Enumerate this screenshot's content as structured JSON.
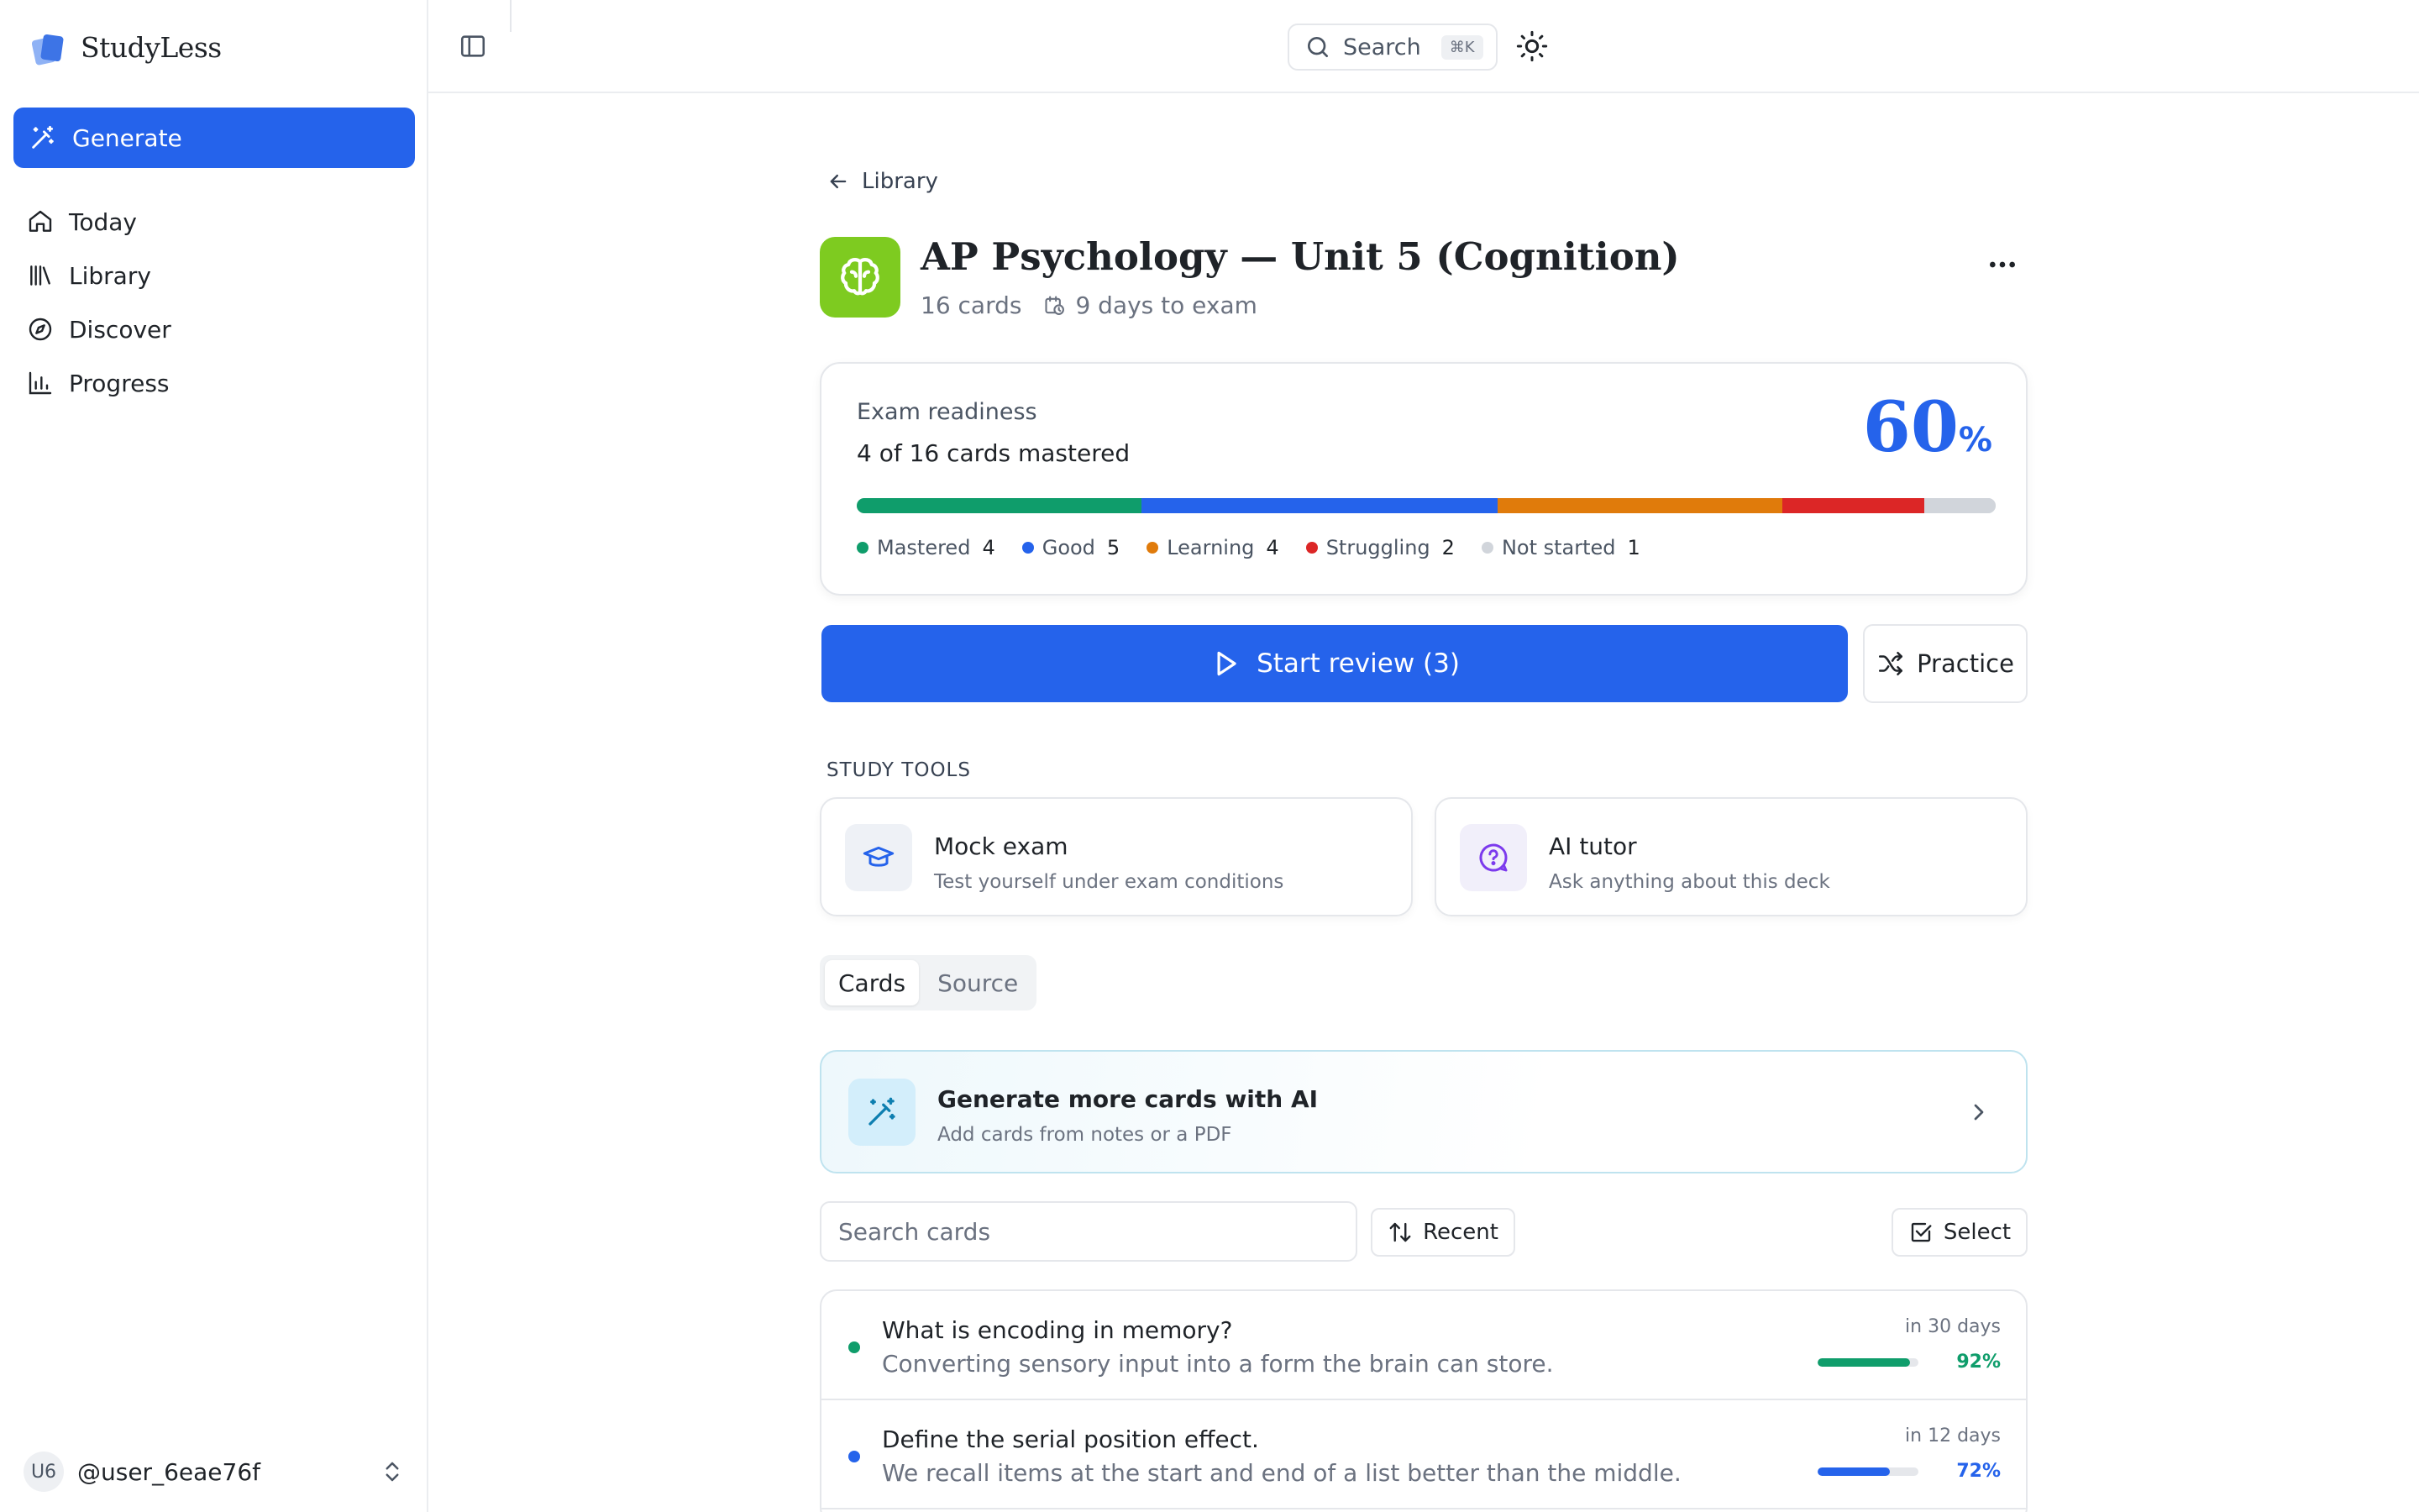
{
  "app": {
    "name": "StudyLess"
  },
  "sidebar": {
    "generate_label": "Generate",
    "items": [
      {
        "label": "Today",
        "icon": "home-icon"
      },
      {
        "label": "Library",
        "icon": "library-icon"
      },
      {
        "label": "Discover",
        "icon": "compass-icon"
      },
      {
        "label": "Progress",
        "icon": "bar-chart-icon"
      }
    ],
    "user": {
      "initials": "U6",
      "name": "@user_6eae76f"
    }
  },
  "topbar": {
    "search_label": "Search",
    "search_shortcut": "⌘K"
  },
  "deck": {
    "back_label": "Library",
    "title": "AP Psychology — Unit 5 (Cognition)",
    "card_count_label": "16 cards",
    "exam_label": "9 days to exam",
    "icon_color": "#7ecb20"
  },
  "readiness": {
    "label": "Exam readiness",
    "summary": "4 of 16 cards mastered",
    "percent": "60",
    "percent_symbol": "%",
    "breakdown": [
      {
        "label": "Mastered",
        "count": 4,
        "color": "#0f9d6b"
      },
      {
        "label": "Good",
        "count": 5,
        "color": "#2563eb"
      },
      {
        "label": "Learning",
        "count": 4,
        "color": "#e07b0b"
      },
      {
        "label": "Struggling",
        "count": 2,
        "color": "#dc2626"
      },
      {
        "label": "Not started",
        "count": 1,
        "color": "#d1d5db"
      }
    ]
  },
  "actions": {
    "start_review_label": "Start review (3)",
    "practice_label": "Practice"
  },
  "study_tools": {
    "section_label": "STUDY TOOLS",
    "mock_exam": {
      "title": "Mock exam",
      "description": "Test yourself under exam conditions"
    },
    "ai_tutor": {
      "title": "AI tutor",
      "description": "Ask anything about this deck"
    }
  },
  "tabs": {
    "cards_label": "Cards",
    "source_label": "Source"
  },
  "ai_banner": {
    "title": "Generate more cards with AI",
    "description": "Add cards from notes or a PDF"
  },
  "card_controls": {
    "search_placeholder": "Search cards",
    "sort_label": "Recent",
    "select_label": "Select"
  },
  "cards": [
    {
      "question": "What is encoding in memory?",
      "answer": "Converting sensory input into a form the brain can store.",
      "due": "in 30 days",
      "strength_label": "92%",
      "strength": 0.92,
      "color": "#0f9d6b"
    },
    {
      "question": "Define the serial position effect.",
      "answer": "We recall items at the start and end of a list better than the middle.",
      "due": "in 12 days",
      "strength_label": "72%",
      "strength": 0.72,
      "color": "#2563eb"
    }
  ]
}
